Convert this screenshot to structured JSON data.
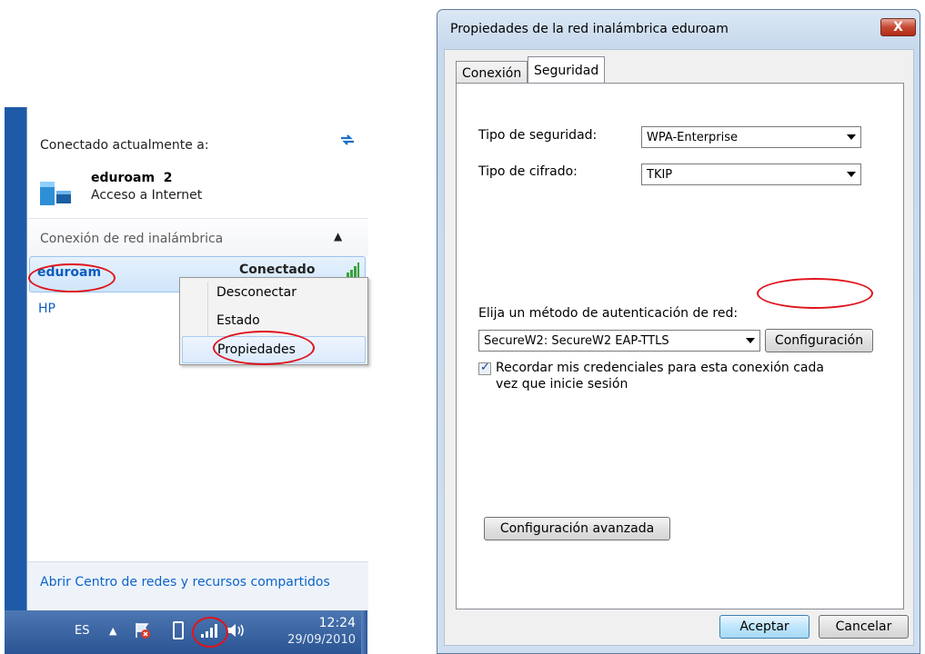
{
  "flyout": {
    "current_header": "Conectado actualmente a:",
    "current_network": "eduroam  2",
    "current_access": "Acceso a Internet",
    "section_title": "Conexión de red inalámbrica",
    "networks": [
      {
        "name": "eduroam",
        "status": "Conectado"
      },
      {
        "name": "HP"
      }
    ],
    "footer_link": "Abrir Centro de redes y recursos compartidos"
  },
  "context_menu": {
    "items": [
      "Desconectar",
      "Estado",
      "Propiedades"
    ],
    "highlighted": "Propiedades"
  },
  "taskbar": {
    "language": "ES",
    "time": "12:24",
    "date": "29/09/2010"
  },
  "dialog": {
    "title": "Propiedades de la red inalámbrica eduroam",
    "close_label": "X",
    "tabs": [
      "Conexión",
      "Seguridad"
    ],
    "active_tab": "Seguridad",
    "security_type_label": "Tipo de seguridad:",
    "security_type_value": "WPA-Enterprise",
    "cipher_type_label": "Tipo de cifrado:",
    "cipher_type_value": "TKIP",
    "auth_method_label": "Elija un método de autenticación de red:",
    "auth_method_value": "SecureW2: SecureW2 EAP-TTLS",
    "config_button": "Configuración",
    "remember_checkbox_line1": "Recordar mis credenciales para esta conexión cada",
    "remember_checkbox_line2": "vez que inicie sesión",
    "remember_checked": true,
    "advanced_button": "Configuración avanzada",
    "ok_button": "Aceptar",
    "cancel_button": "Cancelar"
  },
  "colors": {
    "annotation_red": "#e0141b",
    "link_blue": "#0d63c9",
    "taskbar_blue": "#2b5494"
  }
}
